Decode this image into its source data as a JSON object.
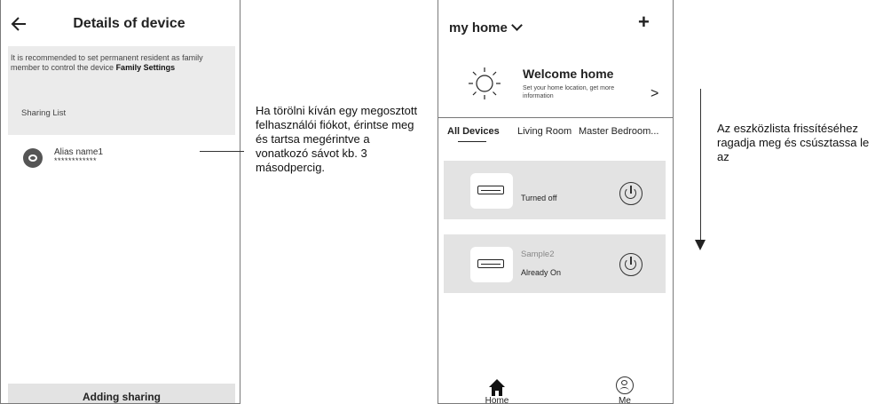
{
  "left_phone": {
    "title": "Details of device",
    "notice_text": "It is recommended to set permanent resident as family member to control the device ",
    "notice_link": "Family Settings",
    "section_label": "Sharing List",
    "member": {
      "name": "Alias name1",
      "masked": "************"
    },
    "bottom_button": "Adding sharing"
  },
  "annotation_left": "Ha törölni kíván egy megosztott felhasználói fiókot, érintse meg és tartsa megérintve a vonatkozó sávot kb. 3 másodpercig.",
  "annotation_right": "Az eszközlista frissítéséhez ragadja meg és csúsztassa le az",
  "right_phone": {
    "home_name": "my home",
    "add_label": "+",
    "welcome_title": "Welcome home",
    "welcome_sub": "Set your home location, get more information",
    "welcome_arrow": ">",
    "tabs": [
      "All Devices",
      "Living Room",
      "Master Bedroom..."
    ],
    "devices": [
      {
        "name": "",
        "status": "Turned off"
      },
      {
        "name": "Sample2",
        "status": "Already On"
      }
    ],
    "nav": {
      "home": "Home",
      "me": "Me"
    }
  }
}
